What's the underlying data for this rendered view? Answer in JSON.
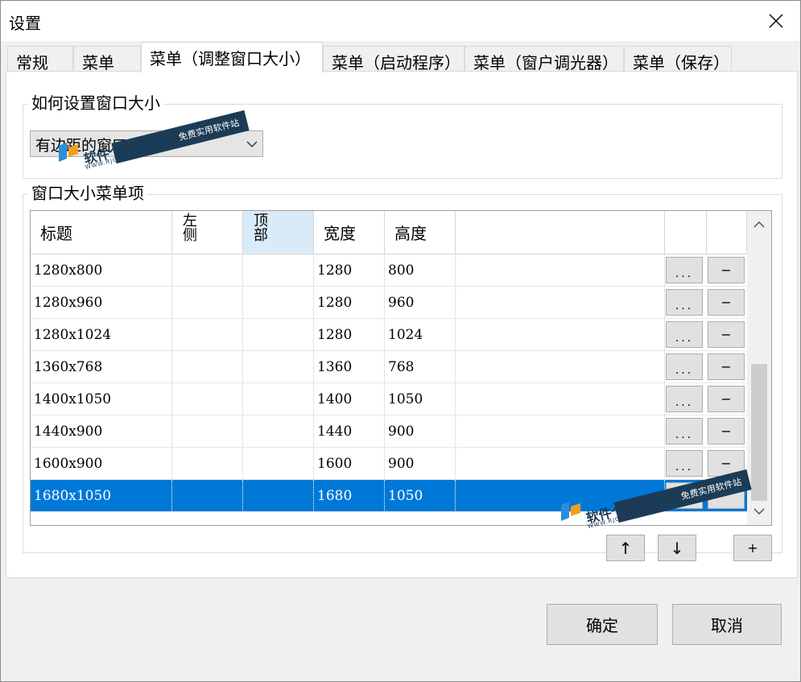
{
  "window": {
    "title": "设置"
  },
  "tabs": [
    {
      "label": "常规"
    },
    {
      "label": "菜单"
    },
    {
      "label": "菜单（调整窗口大小）"
    },
    {
      "label": "菜单（启动程序）"
    },
    {
      "label": "菜单（窗户调光器）"
    },
    {
      "label": "菜单（保存）"
    }
  ],
  "resize_group": {
    "legend": "如何设置窗口大小",
    "selected_option": "有边距的窗口"
  },
  "menu_items_group": {
    "legend": "窗口大小菜单项",
    "columns": {
      "title": "标题",
      "left": "左侧",
      "top": "顶部",
      "width": "宽度",
      "height": "高度"
    },
    "rows": [
      {
        "title": "1280x800",
        "left": "",
        "top": "",
        "width": "1280",
        "height": "800",
        "edit": "...",
        "remove": "−"
      },
      {
        "title": "1280x960",
        "left": "",
        "top": "",
        "width": "1280",
        "height": "960",
        "edit": "...",
        "remove": "−"
      },
      {
        "title": "1280x1024",
        "left": "",
        "top": "",
        "width": "1280",
        "height": "1024",
        "edit": "...",
        "remove": "−"
      },
      {
        "title": "1360x768",
        "left": "",
        "top": "",
        "width": "1360",
        "height": "768",
        "edit": "...",
        "remove": "−"
      },
      {
        "title": "1400x1050",
        "left": "",
        "top": "",
        "width": "1400",
        "height": "1050",
        "edit": "...",
        "remove": "−"
      },
      {
        "title": "1440x900",
        "left": "",
        "top": "",
        "width": "1440",
        "height": "900",
        "edit": "...",
        "remove": "−"
      },
      {
        "title": "1600x900",
        "left": "",
        "top": "",
        "width": "1600",
        "height": "900",
        "edit": "...",
        "remove": "−"
      },
      {
        "title": "1680x1050",
        "left": "",
        "top": "",
        "width": "1680",
        "height": "1050",
        "edit": "",
        "remove": ""
      }
    ],
    "move_up": "↑",
    "move_down": "↓",
    "add": "+"
  },
  "footer": {
    "ok": "确定",
    "cancel": "取消"
  },
  "watermark": {
    "name": "软件个锤子",
    "slogan": "免费实用软件站",
    "url": "WWW.RJGCZ.COM"
  },
  "colors": {
    "selection": "#0078d7",
    "header_highlight": "#d9ebf9",
    "watermark": "#1c3b57"
  }
}
